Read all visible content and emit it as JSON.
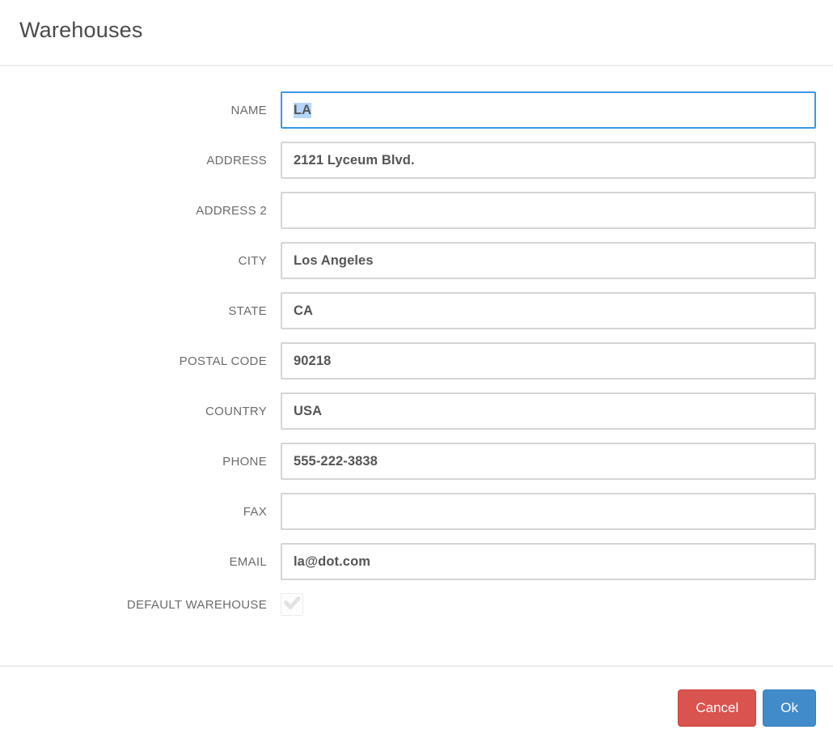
{
  "page": {
    "title": "Warehouses"
  },
  "form": {
    "fields": [
      {
        "id": "name",
        "label": "NAME",
        "value": "LA",
        "focused": true,
        "selected": true
      },
      {
        "id": "address",
        "label": "ADDRESS",
        "value": "2121 Lyceum Blvd.",
        "focused": false,
        "selected": false
      },
      {
        "id": "address2",
        "label": "ADDRESS 2",
        "value": "",
        "focused": false,
        "selected": false
      },
      {
        "id": "city",
        "label": "CITY",
        "value": "Los Angeles",
        "focused": false,
        "selected": false
      },
      {
        "id": "state",
        "label": "STATE",
        "value": "CA",
        "focused": false,
        "selected": false
      },
      {
        "id": "postal-code",
        "label": "POSTAL CODE",
        "value": "90218",
        "focused": false,
        "selected": false
      },
      {
        "id": "country",
        "label": "COUNTRY",
        "value": "USA",
        "focused": false,
        "selected": false
      },
      {
        "id": "phone",
        "label": "PHONE",
        "value": "555-222-3838",
        "focused": false,
        "selected": false
      },
      {
        "id": "fax",
        "label": "FAX",
        "value": "",
        "focused": false,
        "selected": false
      },
      {
        "id": "email",
        "label": "EMAIL",
        "value": "la@dot.com",
        "focused": false,
        "selected": false
      }
    ],
    "default_warehouse": {
      "label": "DEFAULT WAREHOUSE",
      "checked": true,
      "disabled": true
    }
  },
  "footer": {
    "cancel_label": "Cancel",
    "ok_label": "Ok"
  },
  "colors": {
    "focus_border": "#3b97e3",
    "selection_highlight": "#b4d6f8",
    "input_border": "#d5d5d5",
    "cancel_button": "#d9534f",
    "ok_button": "#428bca",
    "checkbox_check": "#e2e2e2"
  }
}
